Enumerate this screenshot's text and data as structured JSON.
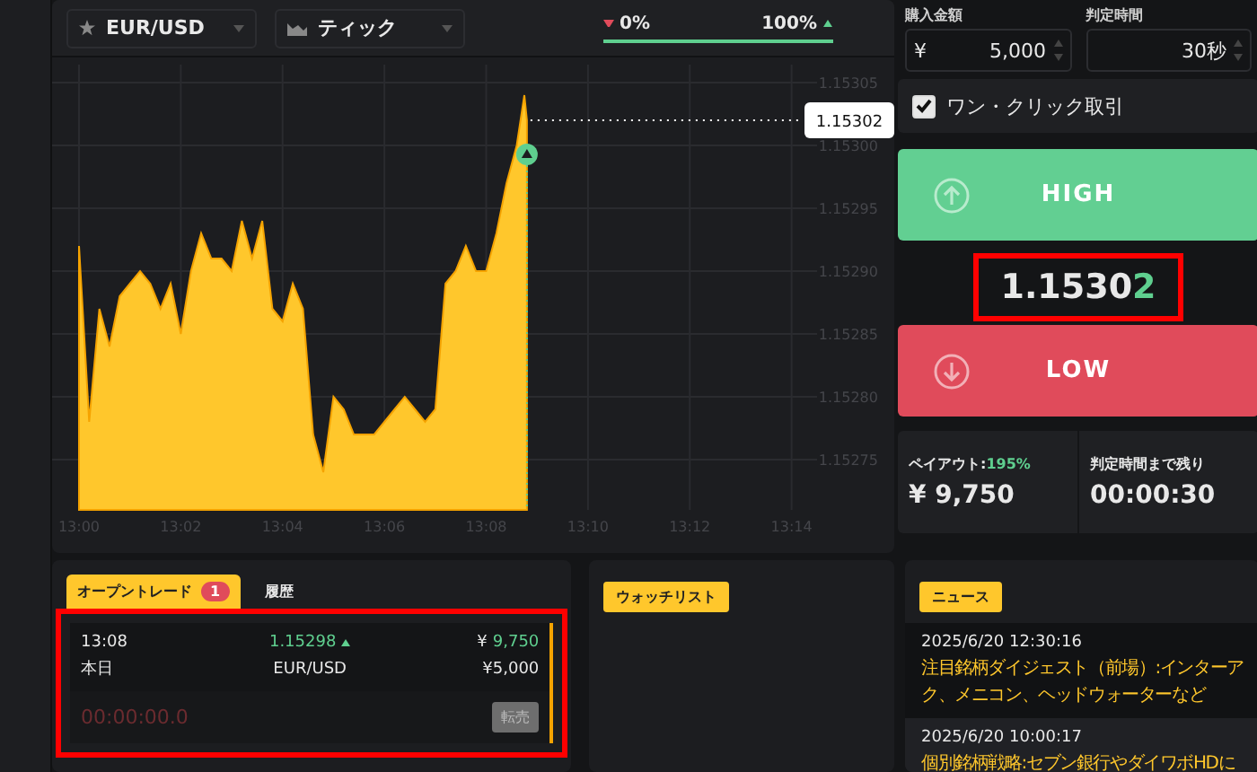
{
  "toolbar": {
    "asset": "EUR/USD",
    "chart_type": "ティック"
  },
  "sentiment": {
    "low": "0%",
    "high": "100%",
    "level": 1
  },
  "chart": {
    "price_tag": "1.15302",
    "chart_data": {
      "type": "area",
      "x": [
        13,
        13.00333,
        13.00667,
        13.01,
        13.01333,
        13.01667,
        13.02,
        13.02333,
        13.02667,
        13.03,
        13.03333,
        13.03667,
        13.04,
        13.04333,
        13.04667,
        13.05,
        13.05333,
        13.05667,
        13.06,
        13.06333,
        13.06667,
        13.07,
        13.07333,
        13.07667,
        13.08,
        13.08333,
        13.08667,
        13.09,
        13.09333,
        13.09667,
        13.1,
        13.10333,
        13.10667,
        13.11,
        13.11333,
        13.11667,
        13.12,
        13.12333,
        13.12667,
        13.13,
        13.13333,
        13.13667,
        13.14,
        13.14333,
        13.145,
        13.14583,
        13.14667
      ],
      "series": [
        {
          "color": "#ffc72c",
          "values": [
            1.15292,
            1.15278,
            1.15287,
            1.15284,
            1.15288,
            1.15289,
            1.1529,
            1.15289,
            1.15287,
            1.15289,
            1.15285,
            1.1529,
            1.15293,
            1.15291,
            1.15291,
            1.1529,
            1.15294,
            1.15291,
            1.15294,
            1.15287,
            1.15286,
            1.15289,
            1.15287,
            1.15277,
            1.15274,
            1.1528,
            1.15279,
            1.15277,
            1.15277,
            1.15277,
            1.15278,
            1.15279,
            1.1528,
            1.15279,
            1.15278,
            1.15279,
            1.15289,
            1.1529,
            1.15292,
            1.1529,
            1.1529,
            1.15293,
            1.15297,
            1.153,
            null,
            1.15304,
            1.15302
          ]
        }
      ],
      "grid": true,
      "ref_lines": [
        {
          "axis": "x",
          "value": 13.14667,
          "color": "#5fcf8f"
        }
      ],
      "xlim": [
        13,
        13.24167
      ],
      "ylim": [
        1.15271,
        1.15305
      ],
      "xticks": [
        {
          "value": 13,
          "label": "13:00"
        },
        {
          "value": 13.03333,
          "label": "13:02"
        },
        {
          "value": 13.06667,
          "label": "13:04"
        },
        {
          "value": 13.1,
          "label": "13:06"
        },
        {
          "value": 13.13333,
          "label": "13:08"
        },
        {
          "value": 13.16667,
          "label": "13:10"
        },
        {
          "value": 13.2,
          "label": "13:12"
        },
        {
          "value": 13.23333,
          "label": "13:14"
        }
      ],
      "yticks": [
        {
          "value": 1.15275,
          "label": "1.15275"
        },
        {
          "value": 1.1528,
          "label": "1.15280"
        },
        {
          "value": 1.15285,
          "label": "1.15285"
        },
        {
          "value": 1.1529,
          "label": "1.15290"
        },
        {
          "value": 1.15295,
          "label": "1.15295"
        },
        {
          "value": 1.153,
          "label": "1.15300"
        },
        {
          "value": 1.15305,
          "label": "1.15305"
        }
      ]
    },
    "entry_rising": true
  },
  "order": {
    "amount_label": "購入金額",
    "currency": "¥",
    "amount": "5,000",
    "duration_label": "判定時間",
    "duration": "30秒",
    "one_click": {
      "label": "ワン・クリック取引",
      "checked": true
    },
    "high_button": "HIGH",
    "price": {
      "main": "1.1530",
      "last_digit": "2",
      "highlighted": true
    },
    "low_button": "LOW",
    "payout_label": "ペイアウト:",
    "payout_rate": "195%",
    "payout": "¥ 9,750",
    "remaining_label": "判定時間まで残り",
    "remaining": "00:00:30"
  },
  "trades": {
    "tabs": [
      {
        "label": "オープントレード",
        "badge": "1",
        "selected": true
      },
      {
        "label": "履歴",
        "selected": false
      }
    ],
    "items": [
      {
        "time": "13:08",
        "day": "本日",
        "price": "1.15298",
        "rising": true,
        "pair": "EUR/USD",
        "currency": "¥",
        "payout": "9,750",
        "amount": "5,000",
        "countdown": "00:00:00.0",
        "sell_button": "転売",
        "sell_enabled": false,
        "highlighted": true
      }
    ]
  },
  "watchlist": {
    "title": "ウォッチリスト"
  },
  "news": {
    "title": "ニュース",
    "items": [
      {
        "date": "2025/6/20 12:30:16",
        "headline": "注目銘柄ダイジェスト（前場）:インターアク、メニコン、ヘッドウォーターなど",
        "selected": true
      },
      {
        "date": "2025/6/20 10:00:17",
        "headline": "個別銘柄戦略:セブン銀行やダイワボHDに",
        "selected": false
      }
    ]
  }
}
